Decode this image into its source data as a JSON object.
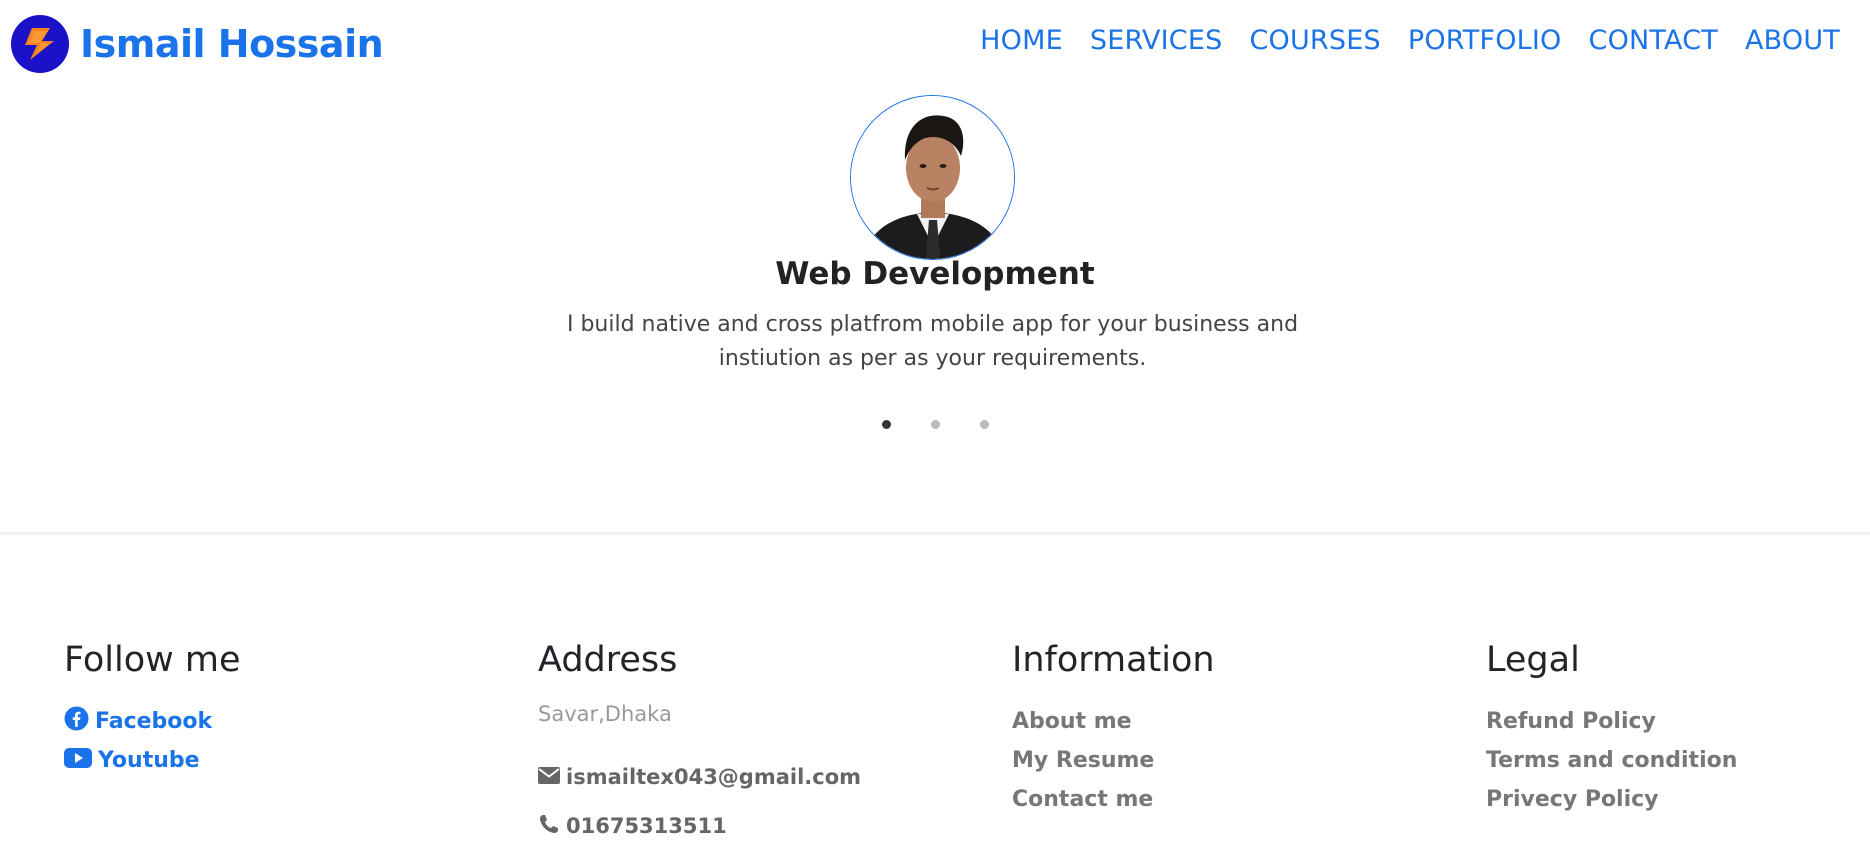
{
  "brand": {
    "name": "Ismail Hossain",
    "logo_icon": "lightning-s-logo",
    "accent": "#1a73e8"
  },
  "nav": {
    "items": [
      {
        "label": "HOME"
      },
      {
        "label": "SERVICES"
      },
      {
        "label": "COURSES"
      },
      {
        "label": "PORTFOLIO"
      },
      {
        "label": "CONTACT"
      },
      {
        "label": "ABOUT"
      }
    ]
  },
  "carousel": {
    "title": "Web Development",
    "description": "I build native and cross platfrom mobile app for your business and instiution as per as your requirements.",
    "slide_count": 3,
    "active_slide": 1
  },
  "footer": {
    "follow": {
      "heading": "Follow me",
      "links": [
        {
          "label": "Facebook",
          "icon": "facebook-icon"
        },
        {
          "label": "Youtube",
          "icon": "youtube-icon"
        }
      ]
    },
    "address": {
      "heading": "Address",
      "location": "Savar,Dhaka",
      "email": "ismailtex043@gmail.com",
      "phone": "01675313511"
    },
    "information": {
      "heading": "Information",
      "links": [
        {
          "label": "About me"
        },
        {
          "label": "My Resume"
        },
        {
          "label": "Contact me"
        }
      ]
    },
    "legal": {
      "heading": "Legal",
      "links": [
        {
          "label": "Refund Policy"
        },
        {
          "label": "Terms and condition"
        },
        {
          "label": "Privecy Policy"
        }
      ]
    }
  }
}
